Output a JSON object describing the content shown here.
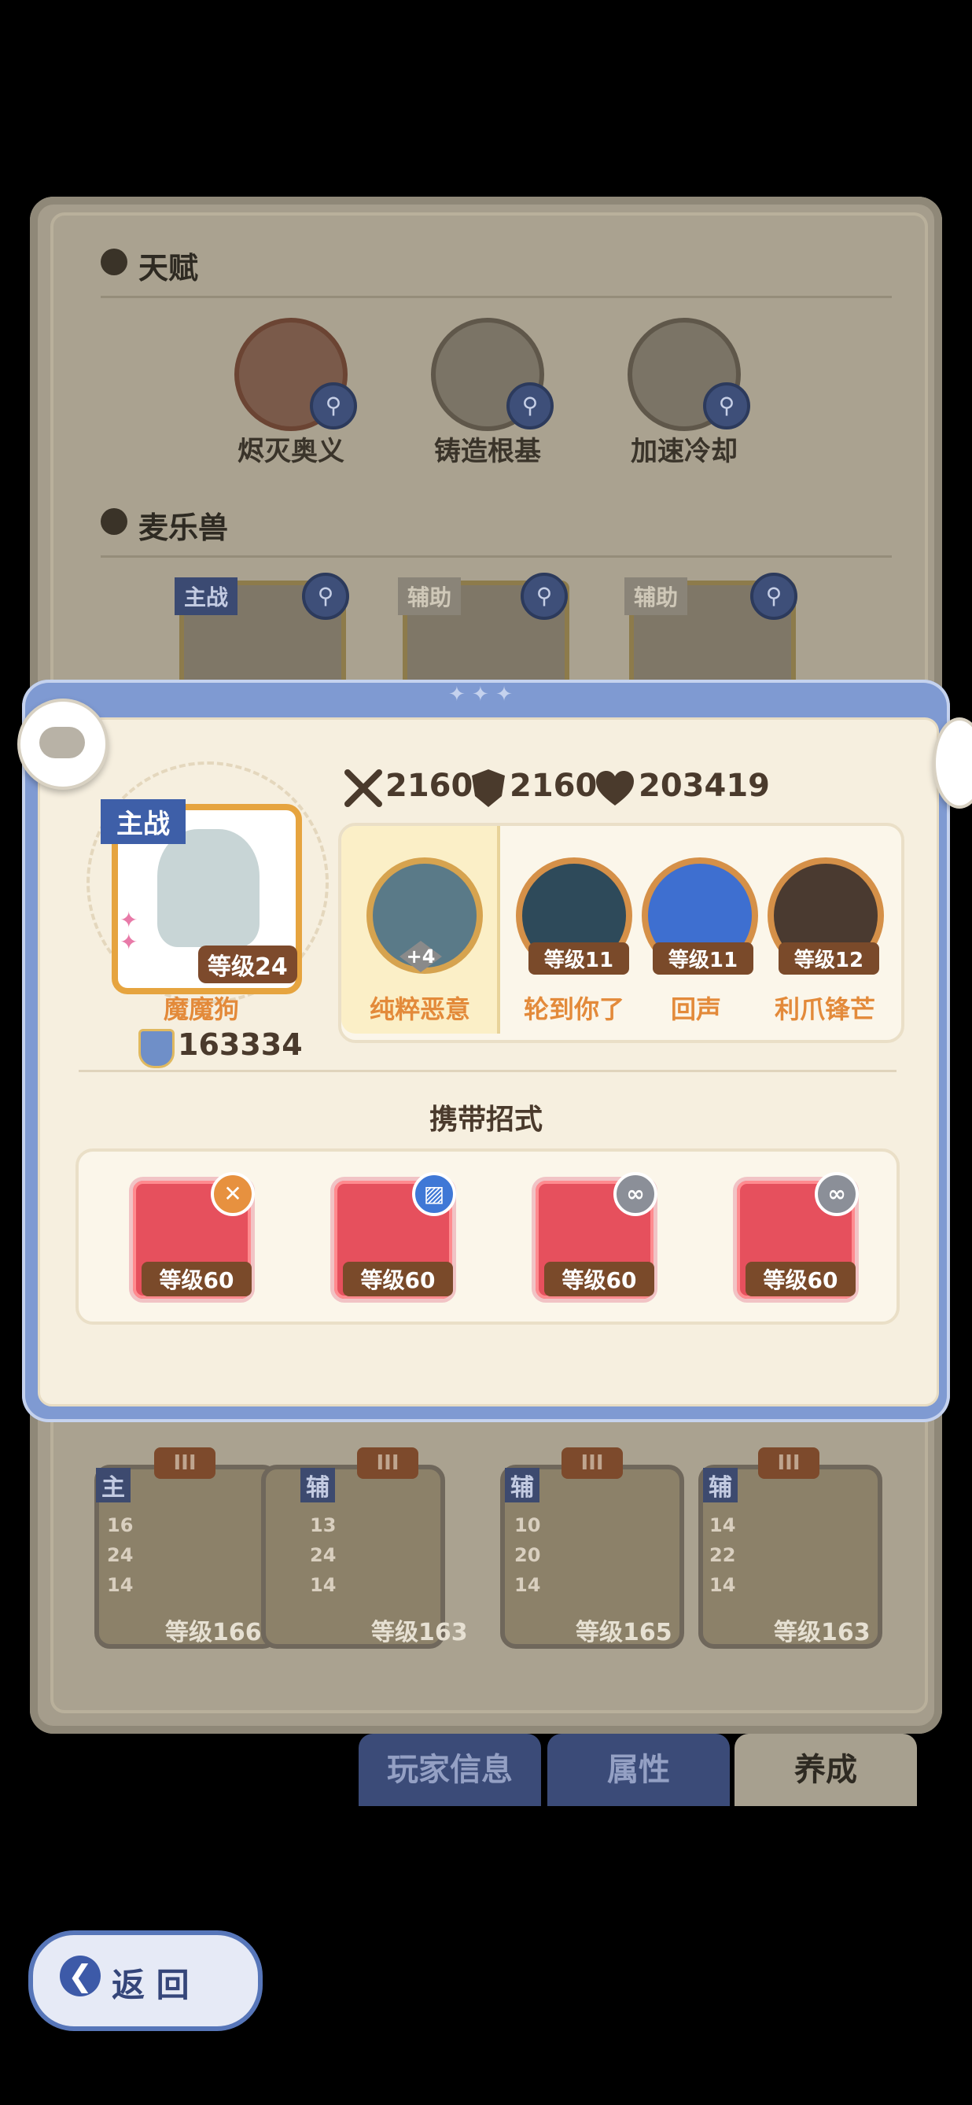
{
  "talent_section": {
    "title": "天赋",
    "items": [
      {
        "label": "烬灭奥义"
      },
      {
        "label": "铸造根基"
      },
      {
        "label": "加速冷却"
      }
    ]
  },
  "pet_section": {
    "title": "麦乐兽",
    "cards": [
      {
        "tag": "主战"
      },
      {
        "tag": "辅助"
      },
      {
        "tag": "辅助"
      }
    ]
  },
  "dialog": {
    "stats": {
      "attack": "2160",
      "defense": "2160",
      "hp": "203419"
    },
    "monster": {
      "tag": "主战",
      "level": "等级24",
      "name": "魔魔狗",
      "power": "163334"
    },
    "skills": [
      {
        "name": "纯粹恶意",
        "badge": "+4",
        "level": ""
      },
      {
        "name": "轮到你了",
        "level": "等级11"
      },
      {
        "name": "回声",
        "level": "等级11"
      },
      {
        "name": "利爪锋芒",
        "level": "等级12"
      }
    ],
    "moves_title": "携带招式",
    "moves": [
      {
        "level": "等级60",
        "badge_icon": "cross-swords-icon"
      },
      {
        "level": "等级60",
        "badge_icon": "shield-icon"
      },
      {
        "level": "等级60",
        "badge_icon": "link-icon"
      },
      {
        "level": "等级60",
        "badge_icon": "link-icon"
      }
    ]
  },
  "bottom_cards": [
    {
      "tag": "主",
      "rank": "III",
      "level": "等级166",
      "stats": [
        "16",
        "24",
        "14"
      ]
    },
    {
      "tag": "辅",
      "rank": "III",
      "level": "等级163",
      "stats": [
        "13",
        "24",
        "14"
      ]
    },
    {
      "tag": "辅",
      "rank": "III",
      "level": "等级165",
      "stats": [
        "10",
        "20",
        "14"
      ]
    },
    {
      "tag": "辅",
      "rank": "III",
      "level": "等级163",
      "stats": [
        "14",
        "22",
        "14"
      ]
    }
  ],
  "tabs": [
    {
      "label": "玩家信息"
    },
    {
      "label": "属性"
    },
    {
      "label": "养成"
    }
  ],
  "back_button": {
    "label": "返 回"
  },
  "colors": {
    "dialog_border": "#7f9ad2",
    "accent_orange": "#e38a3a",
    "level_badge": "#7a4a2a",
    "move_red": "#e6505d"
  }
}
